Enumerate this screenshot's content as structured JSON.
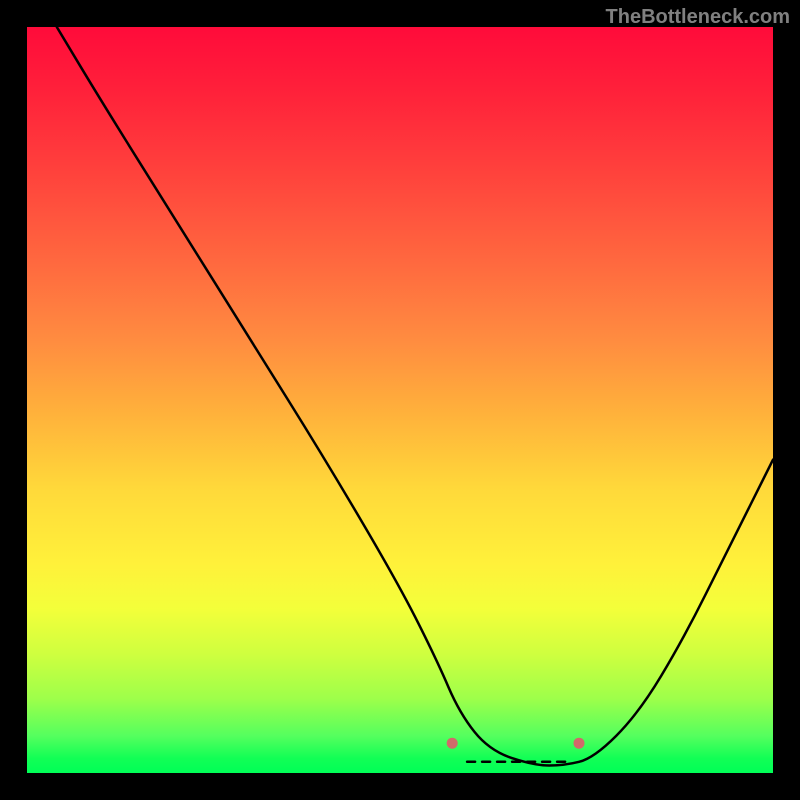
{
  "watermark": "TheBottleneck.com",
  "chart_data": {
    "type": "line",
    "title": "",
    "xlabel": "",
    "ylabel": "",
    "xlim": [
      0,
      100
    ],
    "ylim": [
      0,
      100
    ],
    "grid": false,
    "legend": false,
    "series": [
      {
        "name": "curve",
        "x": [
          4,
          10,
          20,
          30,
          40,
          50,
          55,
          58,
          62,
          68,
          72,
          76,
          82,
          88,
          94,
          100
        ],
        "y": [
          100,
          90,
          74,
          58,
          42,
          25,
          15,
          8,
          3,
          1,
          1,
          2,
          8,
          18,
          30,
          42
        ]
      }
    ],
    "annotations": {
      "marker_dots": [
        {
          "x": 57,
          "y": 4
        },
        {
          "x": 74,
          "y": 4
        }
      ],
      "dashed_segment": {
        "x_start": 59,
        "x_end": 73,
        "y": 1.5
      }
    },
    "background_gradient": {
      "direction": "vertical",
      "stops": [
        {
          "pos": 0.0,
          "color": "#ff0b3a"
        },
        {
          "pos": 0.5,
          "color": "#ffb23b"
        },
        {
          "pos": 0.8,
          "color": "#f3ff3a"
        },
        {
          "pos": 1.0,
          "color": "#00ff57"
        }
      ]
    }
  }
}
